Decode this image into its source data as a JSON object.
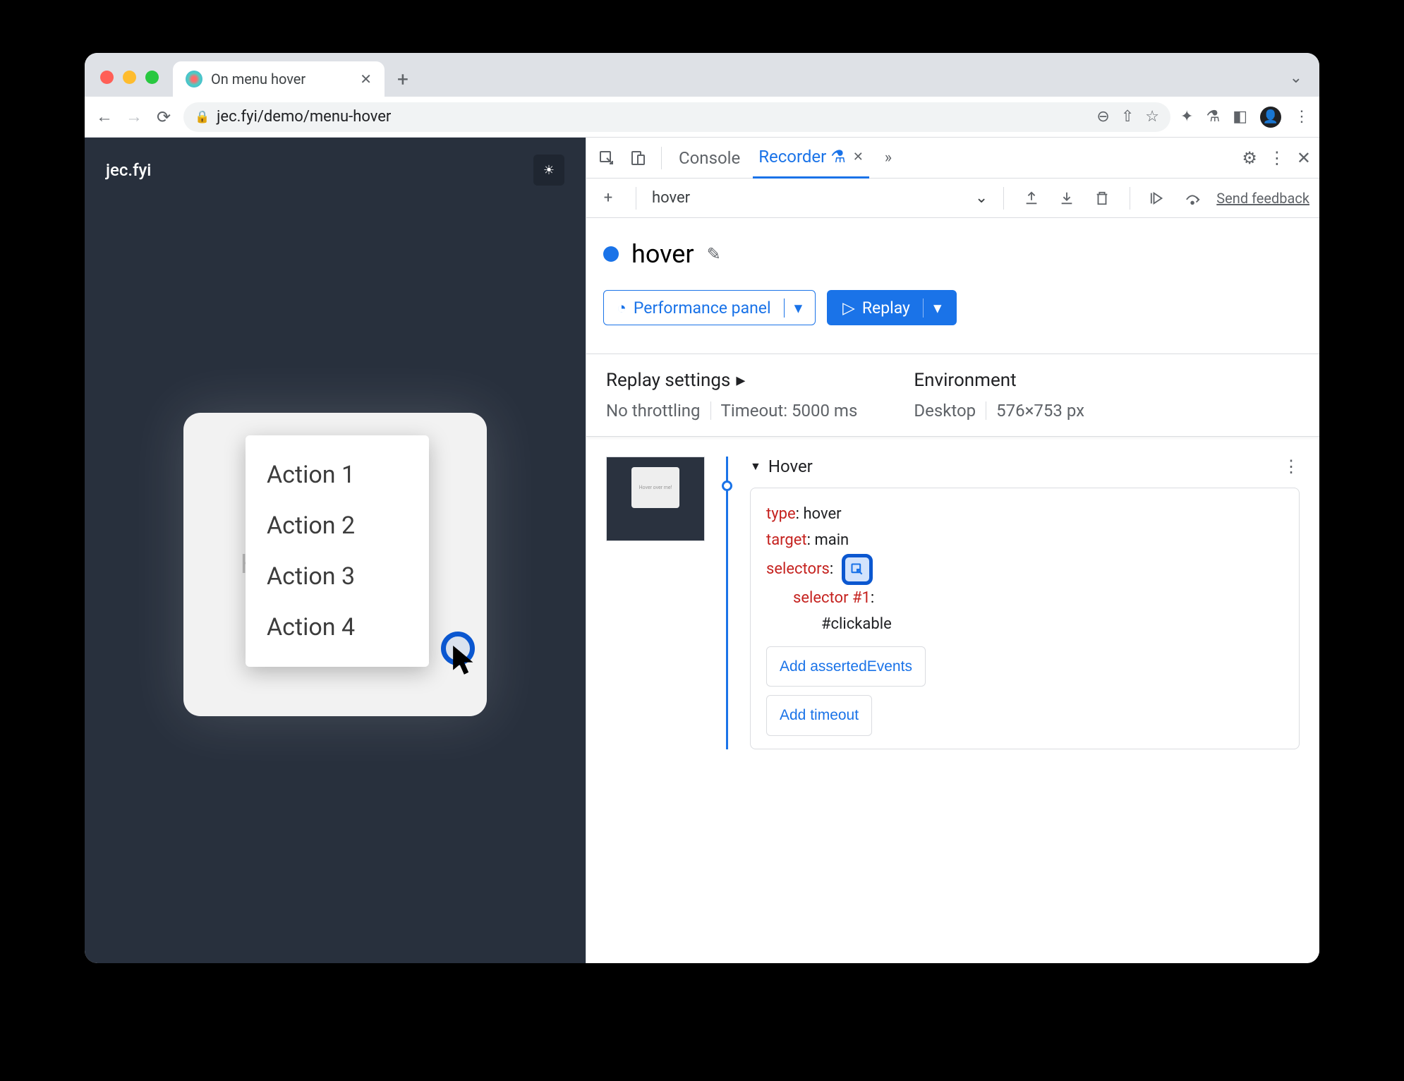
{
  "browser": {
    "tab_title": "On menu hover",
    "url": "jec.fyi/demo/menu-hover"
  },
  "page": {
    "brand": "jec.fyi",
    "card_back_text": "Hover over me!",
    "menu_items": [
      "Action 1",
      "Action 2",
      "Action 3",
      "Action 4"
    ]
  },
  "devtools": {
    "tabs": {
      "console": "Console",
      "recorder": "Recorder"
    },
    "send_feedback": "Send feedback",
    "flow_name": "hover",
    "recording_title": "hover",
    "perf_button": "Performance panel",
    "replay_button": "Replay",
    "replay_settings_label": "Replay settings",
    "env_label": "Environment",
    "throttling": "No throttling",
    "timeout": "Timeout: 5000 ms",
    "device": "Desktop",
    "viewport": "576×753 px",
    "thumb_text": "Hover over me!",
    "step": {
      "name": "Hover",
      "type_key": "type",
      "type_val": "hover",
      "target_key": "target",
      "target_val": "main",
      "selectors_key": "selectors",
      "selector_n_key": "selector #1",
      "selector_val": "#clickable",
      "add_asserted": "Add assertedEvents",
      "add_timeout": "Add timeout"
    }
  }
}
